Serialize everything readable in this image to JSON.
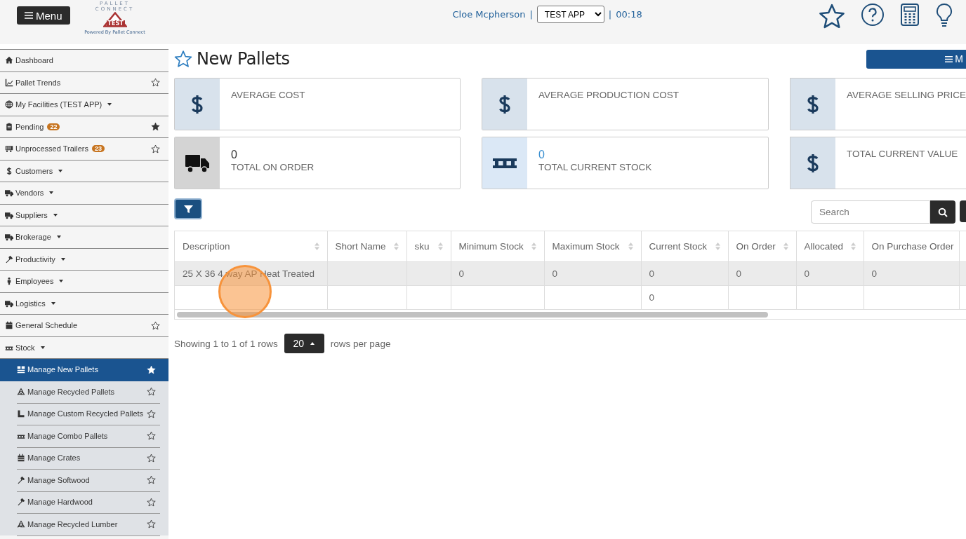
{
  "header": {
    "menu_button": "Menu",
    "logo": {
      "wordmark_top": "PALLET",
      "wordmark_bottom": "CONNECT",
      "badge": "TEST",
      "tagline": "Powered By Pallet Connect"
    },
    "user": "Cloe Mcpherson",
    "separator": "|",
    "app_select": {
      "value": "TEST APP"
    },
    "timer_separator": "|",
    "timer": "00:18"
  },
  "sidebar": {
    "items": [
      {
        "label": "Dashboard",
        "kind": "link"
      },
      {
        "label": "Pallet Trends",
        "kind": "link",
        "starred": false
      },
      {
        "label": "My Facilities (TEST APP)",
        "kind": "menu"
      },
      {
        "label": "Pending",
        "kind": "link",
        "badge": "22",
        "starred": true
      },
      {
        "label": "Unprocessed Trailers",
        "kind": "link",
        "badge": "23",
        "starred": false
      },
      {
        "label": "Customers",
        "kind": "menu"
      },
      {
        "label": "Vendors",
        "kind": "menu"
      },
      {
        "label": "Suppliers",
        "kind": "menu"
      },
      {
        "label": "Brokerage",
        "kind": "menu"
      },
      {
        "label": "Productivity",
        "kind": "menu"
      },
      {
        "label": "Employees",
        "kind": "menu"
      },
      {
        "label": "Logistics",
        "kind": "menu"
      },
      {
        "label": "General Schedule",
        "kind": "link",
        "starred": false
      },
      {
        "label": "Stock",
        "kind": "menu",
        "expanded": true,
        "children": [
          {
            "label": "Manage New Pallets",
            "selected": true,
            "starred": true
          },
          {
            "label": "Manage Recycled Pallets",
            "selected": false,
            "starred": false
          },
          {
            "label": "Manage Custom Recycled Pallets",
            "selected": false,
            "starred": false
          },
          {
            "label": "Manage Combo Pallets",
            "selected": false,
            "starred": false
          },
          {
            "label": "Manage Crates",
            "selected": false,
            "starred": false
          },
          {
            "label": "Manage Softwood",
            "selected": false,
            "starred": false
          },
          {
            "label": "Manage Hardwood",
            "selected": false,
            "starred": false
          },
          {
            "label": "Manage Recycled Lumber",
            "selected": false,
            "starred": false
          }
        ]
      }
    ]
  },
  "page": {
    "title": "New Pallets",
    "favorite": false,
    "actions_button": "M"
  },
  "cards": [
    {
      "kind": "currency",
      "label": "AVERAGE COST"
    },
    {
      "kind": "currency",
      "label": "AVERAGE PRODUCTION COST"
    },
    {
      "kind": "currency",
      "label": "AVERAGE SELLING PRICE"
    },
    {
      "kind": "truck",
      "value": "0",
      "link": false,
      "label": "TOTAL ON ORDER"
    },
    {
      "kind": "pallet",
      "value": "0",
      "link": true,
      "label": "TOTAL CURRENT STOCK"
    },
    {
      "kind": "currency",
      "label": "TOTAL CURRENT VALUE"
    }
  ],
  "search": {
    "placeholder": "Search"
  },
  "table": {
    "columns": [
      {
        "label": "Description",
        "sortable": true
      },
      {
        "label": "Short Name",
        "sortable": true
      },
      {
        "label": "sku",
        "sortable": true
      },
      {
        "label": "Minimum Stock",
        "sortable": true
      },
      {
        "label": "Maximum Stock",
        "sortable": true
      },
      {
        "label": "Current Stock",
        "sortable": true
      },
      {
        "label": "On Order",
        "sortable": true
      },
      {
        "label": "Allocated",
        "sortable": true
      },
      {
        "label": "On Purchase Order",
        "sortable": false
      }
    ],
    "rows": [
      {
        "cells": [
          "25 X 36 4 way AP Heat Treated",
          null,
          null,
          "0",
          "0",
          "0",
          "0",
          "0",
          "0"
        ],
        "highlighted": true,
        "clicked": true
      },
      {
        "cells": [
          null,
          null,
          null,
          null,
          null,
          "0",
          null,
          null,
          null
        ],
        "highlighted": false,
        "clicked": false
      }
    ]
  },
  "pagination": {
    "summary": "Showing 1 to 1 of 1 rows",
    "page_size": "20",
    "suffix": "rows per page"
  }
}
